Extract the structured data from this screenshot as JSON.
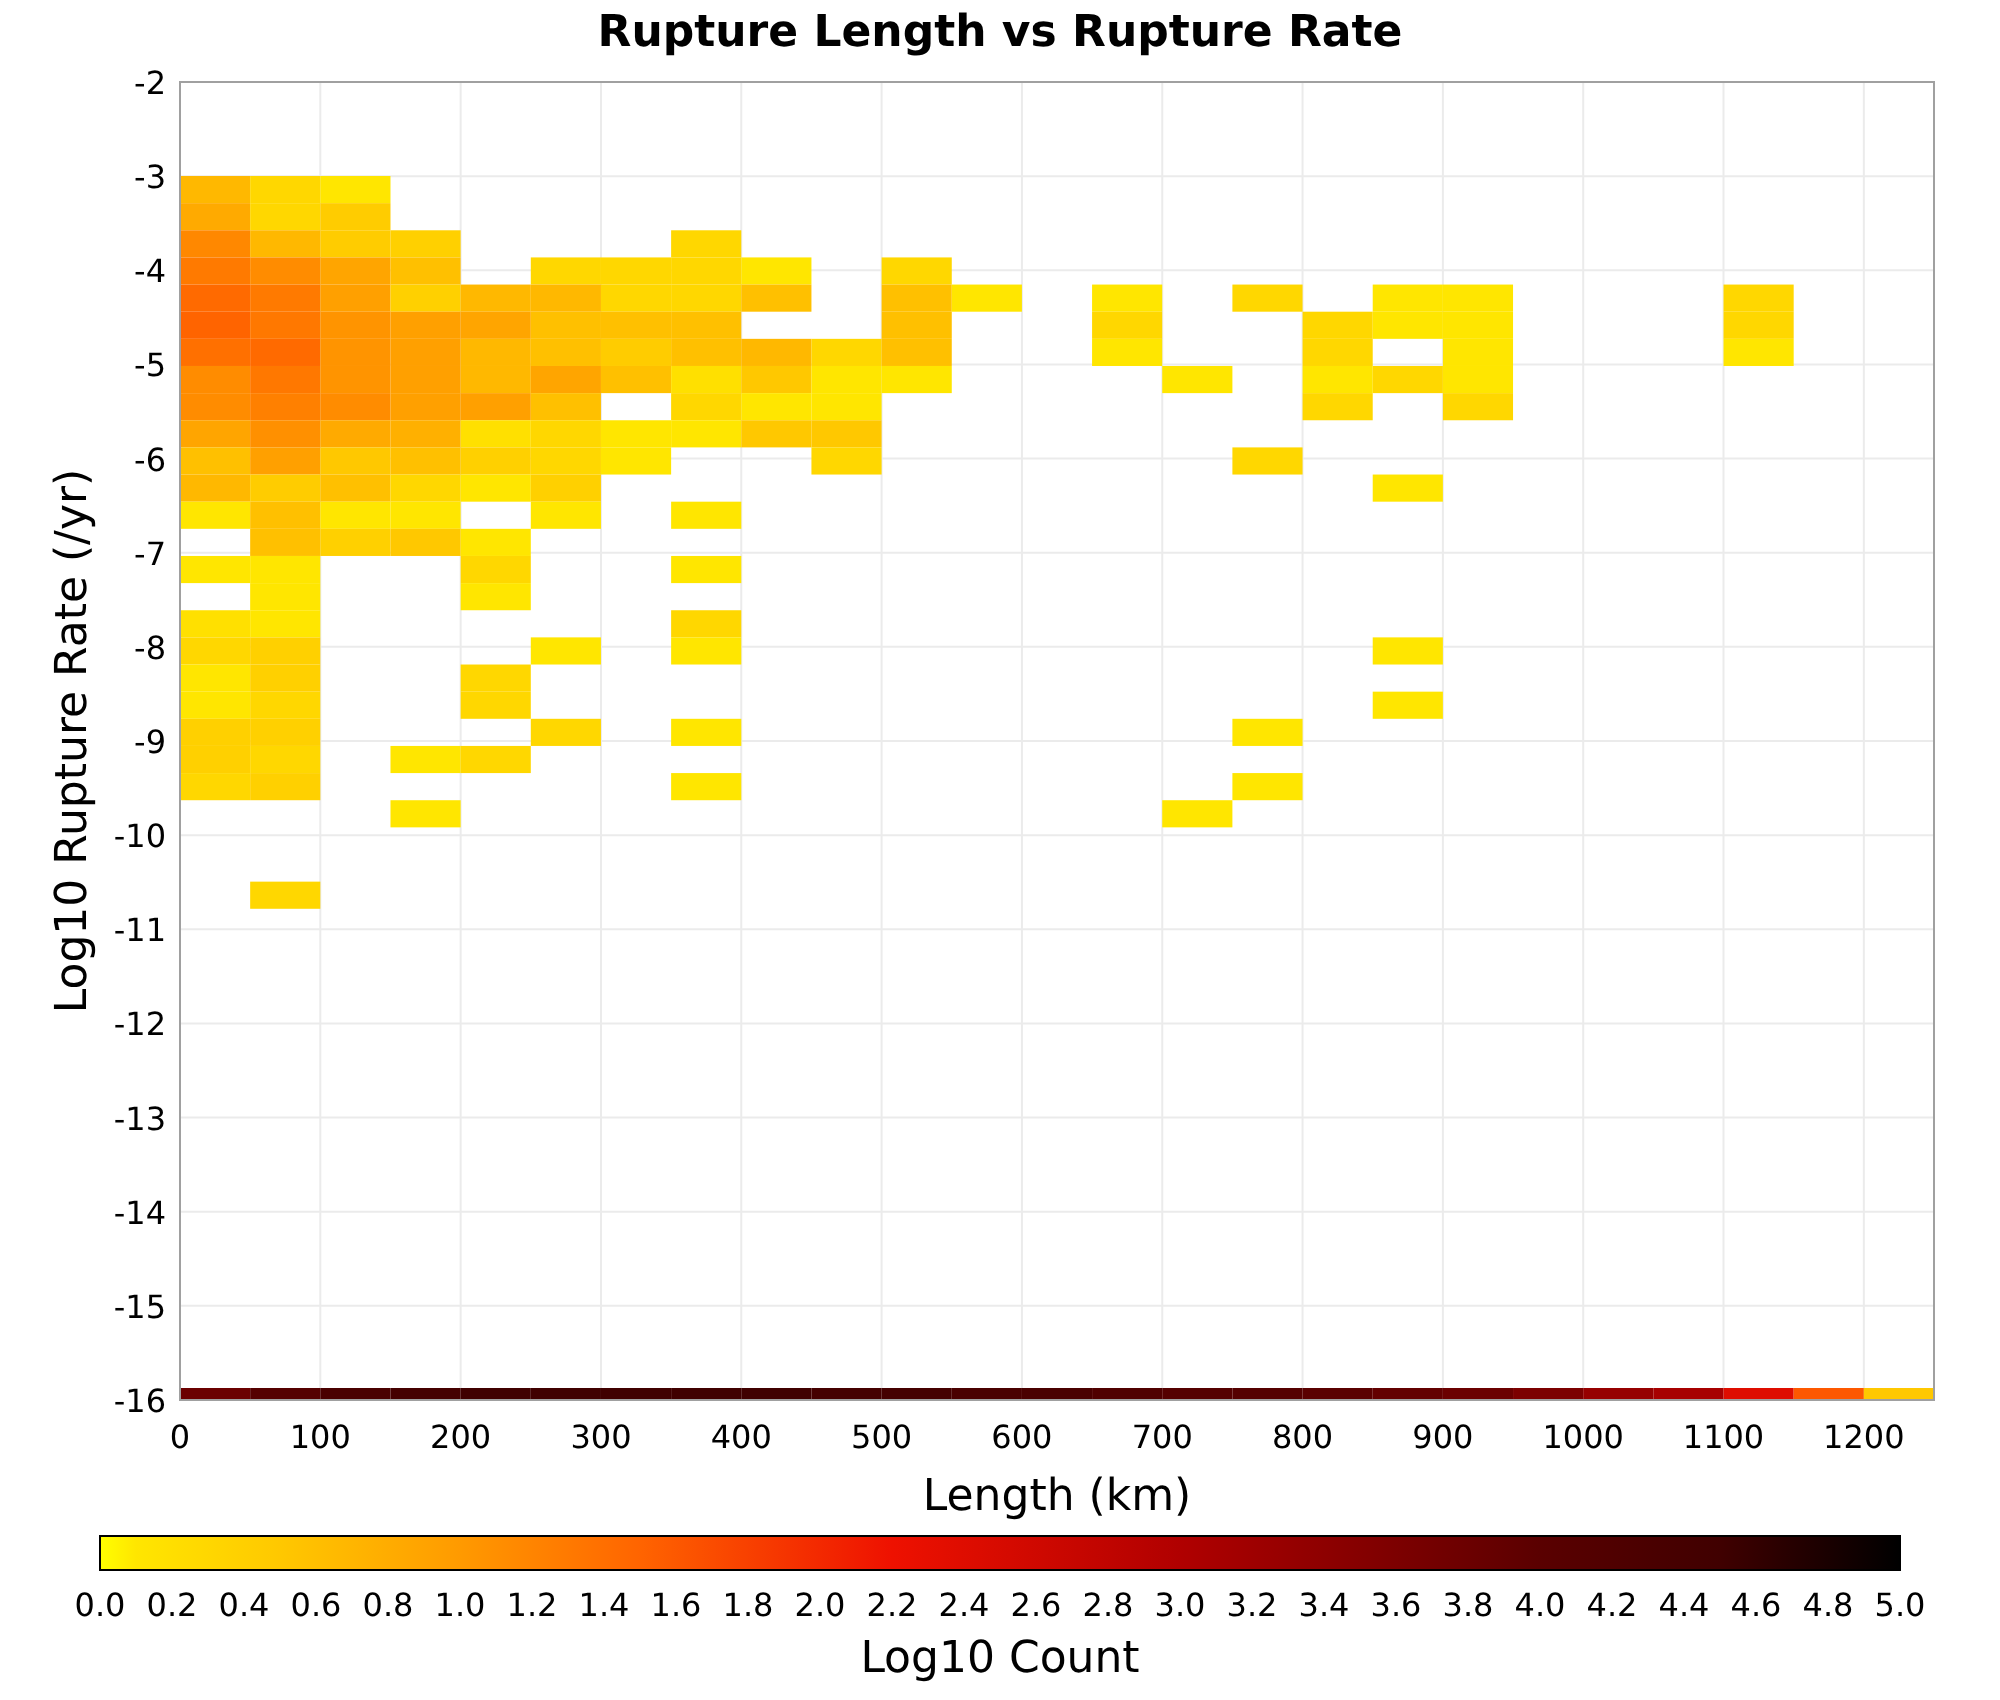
{
  "chart_data": {
    "type": "heatmap",
    "title": "Rupture Length vs Rupture Rate",
    "xlabel": "Length (km)",
    "ylabel": "Log10 Rupture Rate (/yr)",
    "xlim": [
      0,
      1250
    ],
    "ylim": [
      -16,
      -2
    ],
    "xticks": [
      0,
      100,
      200,
      300,
      400,
      500,
      600,
      700,
      800,
      900,
      1000,
      1100,
      1200
    ],
    "yticks": [
      -2,
      -3,
      -4,
      -5,
      -6,
      -7,
      -8,
      -9,
      -10,
      -11,
      -12,
      -13,
      -14,
      -15,
      -16
    ],
    "grid": true
  },
  "heatmap": {
    "rows": [
      {
        "cells": [
          {
            "color": "#ffb800"
          },
          {
            "color": "#ffd700"
          },
          {
            "color": "#ffe600"
          }
        ]
      },
      {
        "cells": [
          {
            "color": "#ffaa00"
          },
          {
            "color": "#ffd700"
          },
          {
            "color": "#ffcc00"
          }
        ]
      },
      {
        "cells": [
          {
            "color": "#ff8800"
          },
          {
            "color": "#ffb800"
          },
          {
            "color": "#ffcc00"
          },
          {
            "color": "#ffd000"
          },
          null,
          null,
          null,
          {
            "color": "#ffd700"
          }
        ]
      },
      {
        "cells": [
          {
            "color": "#ff7a00"
          },
          {
            "color": "#ff8c00"
          },
          {
            "color": "#ffa500"
          },
          {
            "color": "#ffc000"
          },
          null,
          {
            "color": "#ffd700"
          },
          {
            "color": "#ffd700"
          },
          {
            "color": "#ffd700"
          },
          {
            "color": "#ffe600"
          },
          null,
          {
            "color": "#ffd700"
          }
        ]
      },
      {
        "cells": [
          {
            "color": "#ff6a00"
          },
          {
            "color": "#ff7a00"
          },
          {
            "color": "#ffa000"
          },
          {
            "color": "#ffd000"
          },
          {
            "color": "#ffb800"
          },
          {
            "color": "#ffb800"
          },
          {
            "color": "#ffd700"
          },
          {
            "color": "#ffd700"
          },
          {
            "color": "#ffc000"
          },
          null,
          {
            "color": "#ffc000"
          },
          {
            "color": "#ffe600"
          },
          null,
          {
            "color": "#ffe600"
          },
          null,
          {
            "color": "#ffd700"
          },
          null,
          {
            "color": "#ffe600"
          },
          {
            "color": "#ffe600"
          },
          null,
          null,
          null,
          {
            "color": "#ffd700"
          }
        ]
      },
      {
        "cells": [
          {
            "color": "#ff6400"
          },
          {
            "color": "#ff7800"
          },
          {
            "color": "#ff9400"
          },
          {
            "color": "#ffa000"
          },
          {
            "color": "#ffa500"
          },
          {
            "color": "#ffc000"
          },
          {
            "color": "#ffc000"
          },
          {
            "color": "#ffc000"
          },
          null,
          null,
          {
            "color": "#ffc000"
          },
          null,
          null,
          {
            "color": "#ffd700"
          },
          null,
          null,
          {
            "color": "#ffd700"
          },
          {
            "color": "#ffe600"
          },
          {
            "color": "#ffe600"
          },
          null,
          null,
          null,
          {
            "color": "#ffd700"
          }
        ]
      },
      {
        "cells": [
          {
            "color": "#ff7000"
          },
          {
            "color": "#ff6a00"
          },
          {
            "color": "#ff9400"
          },
          {
            "color": "#ffa000"
          },
          {
            "color": "#ffb800"
          },
          {
            "color": "#ffc000"
          },
          {
            "color": "#ffcc00"
          },
          {
            "color": "#ffc000"
          },
          {
            "color": "#ffb800"
          },
          {
            "color": "#ffd700"
          },
          {
            "color": "#ffc000"
          },
          null,
          null,
          {
            "color": "#ffe600"
          },
          null,
          null,
          {
            "color": "#ffd700"
          },
          null,
          {
            "color": "#ffe600"
          },
          null,
          null,
          null,
          {
            "color": "#ffe600"
          }
        ]
      },
      {
        "cells": [
          {
            "color": "#ff8c00"
          },
          {
            "color": "#ff7800"
          },
          {
            "color": "#ff9400"
          },
          {
            "color": "#ffa000"
          },
          {
            "color": "#ffb800"
          },
          {
            "color": "#ffa500"
          },
          {
            "color": "#ffc000"
          },
          {
            "color": "#ffe000"
          },
          {
            "color": "#ffc800"
          },
          {
            "color": "#ffe600"
          },
          {
            "color": "#ffe600"
          },
          null,
          null,
          null,
          {
            "color": "#ffe600"
          },
          null,
          {
            "color": "#ffe600"
          },
          {
            "color": "#ffd700"
          },
          {
            "color": "#ffe600"
          }
        ]
      },
      {
        "cells": [
          {
            "color": "#ff8c00"
          },
          {
            "color": "#ff8000"
          },
          {
            "color": "#ff8c00"
          },
          {
            "color": "#ffa000"
          },
          {
            "color": "#ffa000"
          },
          {
            "color": "#ffc000"
          },
          null,
          {
            "color": "#ffd700"
          },
          {
            "color": "#ffe600"
          },
          {
            "color": "#ffe600"
          },
          null,
          null,
          null,
          null,
          null,
          null,
          {
            "color": "#ffd700"
          },
          null,
          {
            "color": "#ffd700"
          }
        ]
      },
      {
        "cells": [
          {
            "color": "#ffa500"
          },
          {
            "color": "#ff9000"
          },
          {
            "color": "#ffaa00"
          },
          {
            "color": "#ffb000"
          },
          {
            "color": "#ffe000"
          },
          {
            "color": "#ffd700"
          },
          {
            "color": "#ffe600"
          },
          {
            "color": "#ffe600"
          },
          {
            "color": "#ffc800"
          },
          {
            "color": "#ffc800"
          }
        ]
      },
      {
        "cells": [
          {
            "color": "#ffc000"
          },
          {
            "color": "#ffa000"
          },
          {
            "color": "#ffc800"
          },
          {
            "color": "#ffc000"
          },
          {
            "color": "#ffd000"
          },
          {
            "color": "#ffd700"
          },
          {
            "color": "#ffe600"
          },
          null,
          null,
          {
            "color": "#ffd700"
          },
          null,
          null,
          null,
          null,
          null,
          {
            "color": "#ffd700"
          }
        ]
      },
      {
        "cells": [
          {
            "color": "#ffb800"
          },
          {
            "color": "#ffcc00"
          },
          {
            "color": "#ffc000"
          },
          {
            "color": "#ffd700"
          },
          {
            "color": "#ffe600"
          },
          {
            "color": "#ffd000"
          },
          null,
          null,
          null,
          null,
          null,
          null,
          null,
          null,
          null,
          null,
          null,
          {
            "color": "#ffe600"
          }
        ]
      },
      {
        "cells": [
          {
            "color": "#ffe600"
          },
          {
            "color": "#ffc000"
          },
          {
            "color": "#ffe600"
          },
          {
            "color": "#ffe600"
          },
          null,
          {
            "color": "#ffe600"
          },
          null,
          {
            "color": "#ffe600"
          }
        ]
      },
      {
        "cells": [
          null,
          {
            "color": "#ffc000"
          },
          {
            "color": "#ffd000"
          },
          {
            "color": "#ffc800"
          },
          {
            "color": "#ffe600"
          }
        ]
      },
      {
        "cells": [
          {
            "color": "#ffe600"
          },
          {
            "color": "#ffe600"
          },
          null,
          null,
          {
            "color": "#ffd700"
          },
          null,
          null,
          {
            "color": "#ffe600"
          }
        ]
      },
      {
        "cells": [
          null,
          {
            "color": "#ffe600"
          },
          null,
          null,
          {
            "color": "#ffe600"
          }
        ]
      },
      {
        "cells": [
          {
            "color": "#ffe000"
          },
          {
            "color": "#ffe600"
          },
          null,
          null,
          null,
          null,
          null,
          {
            "color": "#ffd700"
          }
        ]
      },
      {
        "cells": [
          {
            "color": "#ffd700"
          },
          {
            "color": "#ffd000"
          },
          null,
          null,
          null,
          {
            "color": "#ffe600"
          },
          null,
          {
            "color": "#ffe600"
          },
          null,
          null,
          null,
          null,
          null,
          null,
          null,
          null,
          null,
          {
            "color": "#ffe600"
          }
        ]
      },
      {
        "cells": [
          {
            "color": "#ffe600"
          },
          {
            "color": "#ffd000"
          },
          null,
          null,
          {
            "color": "#ffd700"
          }
        ]
      },
      {
        "cells": [
          {
            "color": "#ffe600"
          },
          {
            "color": "#ffd700"
          },
          null,
          null,
          {
            "color": "#ffd700"
          },
          null,
          null,
          null,
          null,
          null,
          null,
          null,
          null,
          null,
          null,
          null,
          null,
          {
            "color": "#ffe600"
          }
        ]
      },
      {
        "cells": [
          {
            "color": "#ffd000"
          },
          {
            "color": "#ffd000"
          },
          null,
          null,
          null,
          {
            "color": "#ffd700"
          },
          null,
          {
            "color": "#ffe600"
          },
          null,
          null,
          null,
          null,
          null,
          null,
          null,
          {
            "color": "#ffe600"
          }
        ]
      },
      {
        "cells": [
          {
            "color": "#ffd000"
          },
          {
            "color": "#ffd700"
          },
          null,
          {
            "color": "#ffe600"
          },
          {
            "color": "#ffd700"
          }
        ]
      },
      {
        "cells": [
          {
            "color": "#ffd700"
          },
          {
            "color": "#ffd000"
          },
          null,
          null,
          null,
          null,
          null,
          {
            "color": "#ffe600"
          },
          null,
          null,
          null,
          null,
          null,
          null,
          null,
          {
            "color": "#ffe600"
          }
        ]
      },
      {
        "cells": [
          null,
          null,
          null,
          {
            "color": "#ffe600"
          },
          null,
          null,
          null,
          null,
          null,
          null,
          null,
          null,
          null,
          null,
          {
            "color": "#ffe600"
          }
        ]
      },
      {
        "cells": [
          null
        ]
      },
      {
        "cells": [
          null
        ]
      },
      {
        "cells": [
          null,
          {
            "color": "#ffd700"
          }
        ]
      }
    ],
    "bottom_row": {
      "cells": [
        {
          "color": "#6b0000"
        },
        {
          "color": "#550000"
        },
        {
          "color": "#4a0000"
        },
        {
          "color": "#450000"
        },
        {
          "color": "#400000"
        },
        {
          "color": "#400000"
        },
        {
          "color": "#400000"
        },
        {
          "color": "#400000"
        },
        {
          "color": "#400000"
        },
        {
          "color": "#450000"
        },
        {
          "color": "#450000"
        },
        {
          "color": "#4a0000"
        },
        {
          "color": "#4a0000"
        },
        {
          "color": "#500000"
        },
        {
          "color": "#550000"
        },
        {
          "color": "#550000"
        },
        {
          "color": "#5a0000"
        },
        {
          "color": "#630000"
        },
        {
          "color": "#6b0000"
        },
        {
          "color": "#7c0000"
        },
        {
          "color": "#960000"
        },
        {
          "color": "#a70000"
        },
        {
          "color": "#de0d00"
        },
        {
          "color": "#fd5800"
        },
        {
          "color": "#ffc800"
        }
      ]
    }
  },
  "colorbar": {
    "label": "Log10 Count",
    "ticks": [
      "0.0",
      "0.2",
      "0.4",
      "0.6",
      "0.8",
      "1.0",
      "1.2",
      "1.4",
      "1.6",
      "1.8",
      "2.0",
      "2.2",
      "2.4",
      "2.6",
      "2.8",
      "3.0",
      "3.2",
      "3.4",
      "3.6",
      "3.8",
      "4.0",
      "4.2",
      "4.4",
      "4.6",
      "4.8",
      "5.0"
    ]
  }
}
